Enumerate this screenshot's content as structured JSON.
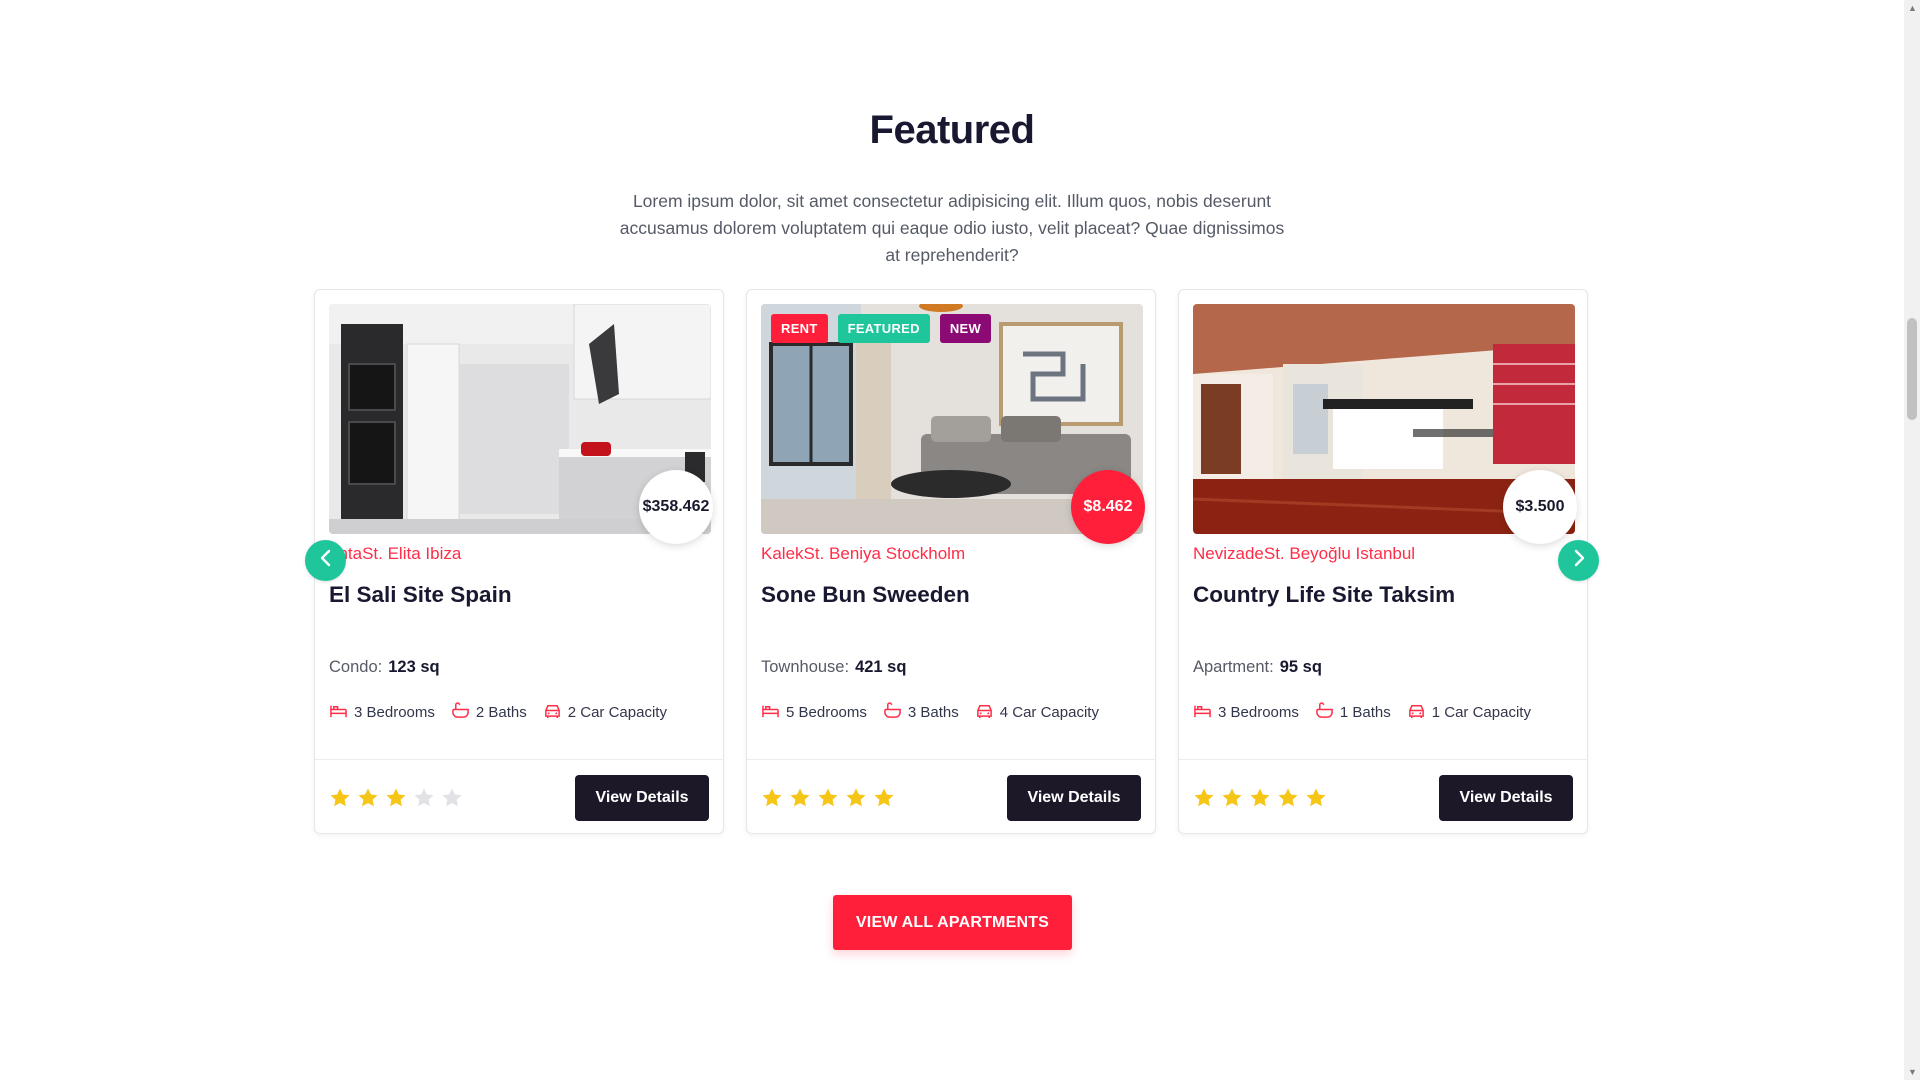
{
  "section": {
    "title": "Featured",
    "description": "Lorem ipsum dolor, sit amet consectetur adipisicing elit. Illum quos, nobis deserunt accusamus dolorem voluptatem qui eaque odio iusto, velit placeat? Quae dignissimos at reprehenderit?"
  },
  "listings": [
    {
      "price": "$358.462",
      "location": "antaSt. Elita Ibiza",
      "title": "El Sali Site Spain",
      "type_label": "Condo:",
      "area": "123 sq",
      "bedrooms": "3 Bedrooms",
      "baths": "2 Baths",
      "cars": "2 Car Capacity",
      "rating": 3,
      "button": "View Details",
      "badges": []
    },
    {
      "price": "$8.462",
      "location": "KalekSt. Beniya Stockholm",
      "title": "Sone Bun Sweeden",
      "type_label": "Townhouse:",
      "area": "421 sq",
      "bedrooms": "5 Bedrooms",
      "baths": "3 Baths",
      "cars": "4 Car Capacity",
      "rating": 5,
      "button": "View Details",
      "badges": [
        {
          "label": "RENT",
          "color": "#ff1f3a"
        },
        {
          "label": "FEATURED",
          "color": "#1fc69b"
        },
        {
          "label": "NEW",
          "color": "#8b0a73"
        }
      ]
    },
    {
      "price": "$3.500",
      "location": "NevizadeSt. Beyoğlu Istanbul",
      "title": "Country Life Site Taksim",
      "type_label": "Apartment:",
      "area": "95 sq",
      "bedrooms": "3 Bedrooms",
      "baths": "1 Baths",
      "cars": "1 Car Capacity",
      "rating": 5,
      "button": "View Details",
      "badges": []
    }
  ],
  "carousel": {
    "prev_icon": "chevron-left-icon",
    "next_icon": "chevron-right-icon"
  },
  "cta": {
    "label": "VIEW ALL APARTMENTS"
  },
  "colors": {
    "accent": "#ff1f3a",
    "teal": "#1fc69b",
    "dark": "#1c1828",
    "star_on": "#f5c518",
    "star_off": "#e2e2e6"
  }
}
